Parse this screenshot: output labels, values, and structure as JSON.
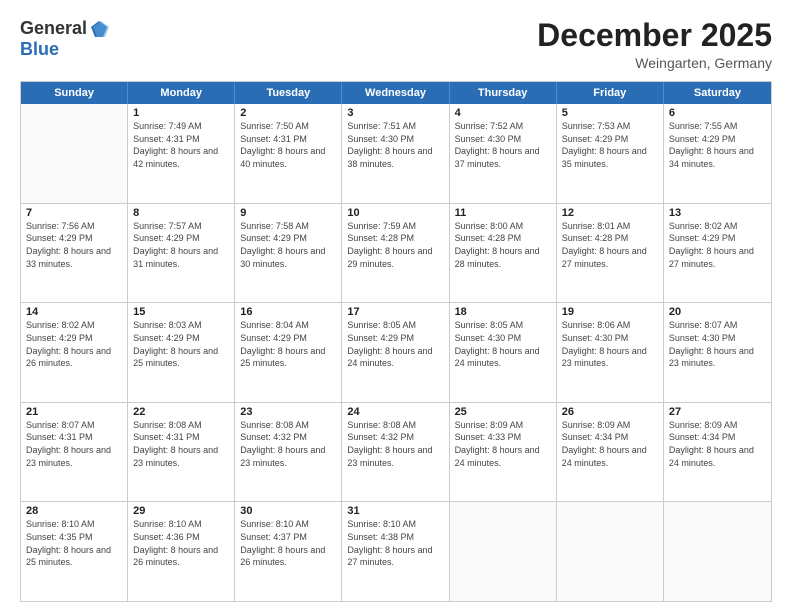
{
  "logo": {
    "general": "General",
    "blue": "Blue"
  },
  "title": "December 2025",
  "location": "Weingarten, Germany",
  "header_days": [
    "Sunday",
    "Monday",
    "Tuesday",
    "Wednesday",
    "Thursday",
    "Friday",
    "Saturday"
  ],
  "weeks": [
    [
      {
        "day": "",
        "empty": true
      },
      {
        "day": "1",
        "sunrise": "Sunrise: 7:49 AM",
        "sunset": "Sunset: 4:31 PM",
        "daylight": "Daylight: 8 hours and 42 minutes."
      },
      {
        "day": "2",
        "sunrise": "Sunrise: 7:50 AM",
        "sunset": "Sunset: 4:31 PM",
        "daylight": "Daylight: 8 hours and 40 minutes."
      },
      {
        "day": "3",
        "sunrise": "Sunrise: 7:51 AM",
        "sunset": "Sunset: 4:30 PM",
        "daylight": "Daylight: 8 hours and 38 minutes."
      },
      {
        "day": "4",
        "sunrise": "Sunrise: 7:52 AM",
        "sunset": "Sunset: 4:30 PM",
        "daylight": "Daylight: 8 hours and 37 minutes."
      },
      {
        "day": "5",
        "sunrise": "Sunrise: 7:53 AM",
        "sunset": "Sunset: 4:29 PM",
        "daylight": "Daylight: 8 hours and 35 minutes."
      },
      {
        "day": "6",
        "sunrise": "Sunrise: 7:55 AM",
        "sunset": "Sunset: 4:29 PM",
        "daylight": "Daylight: 8 hours and 34 minutes."
      }
    ],
    [
      {
        "day": "7",
        "sunrise": "Sunrise: 7:56 AM",
        "sunset": "Sunset: 4:29 PM",
        "daylight": "Daylight: 8 hours and 33 minutes."
      },
      {
        "day": "8",
        "sunrise": "Sunrise: 7:57 AM",
        "sunset": "Sunset: 4:29 PM",
        "daylight": "Daylight: 8 hours and 31 minutes."
      },
      {
        "day": "9",
        "sunrise": "Sunrise: 7:58 AM",
        "sunset": "Sunset: 4:29 PM",
        "daylight": "Daylight: 8 hours and 30 minutes."
      },
      {
        "day": "10",
        "sunrise": "Sunrise: 7:59 AM",
        "sunset": "Sunset: 4:28 PM",
        "daylight": "Daylight: 8 hours and 29 minutes."
      },
      {
        "day": "11",
        "sunrise": "Sunrise: 8:00 AM",
        "sunset": "Sunset: 4:28 PM",
        "daylight": "Daylight: 8 hours and 28 minutes."
      },
      {
        "day": "12",
        "sunrise": "Sunrise: 8:01 AM",
        "sunset": "Sunset: 4:28 PM",
        "daylight": "Daylight: 8 hours and 27 minutes."
      },
      {
        "day": "13",
        "sunrise": "Sunrise: 8:02 AM",
        "sunset": "Sunset: 4:29 PM",
        "daylight": "Daylight: 8 hours and 27 minutes."
      }
    ],
    [
      {
        "day": "14",
        "sunrise": "Sunrise: 8:02 AM",
        "sunset": "Sunset: 4:29 PM",
        "daylight": "Daylight: 8 hours and 26 minutes."
      },
      {
        "day": "15",
        "sunrise": "Sunrise: 8:03 AM",
        "sunset": "Sunset: 4:29 PM",
        "daylight": "Daylight: 8 hours and 25 minutes."
      },
      {
        "day": "16",
        "sunrise": "Sunrise: 8:04 AM",
        "sunset": "Sunset: 4:29 PM",
        "daylight": "Daylight: 8 hours and 25 minutes."
      },
      {
        "day": "17",
        "sunrise": "Sunrise: 8:05 AM",
        "sunset": "Sunset: 4:29 PM",
        "daylight": "Daylight: 8 hours and 24 minutes."
      },
      {
        "day": "18",
        "sunrise": "Sunrise: 8:05 AM",
        "sunset": "Sunset: 4:30 PM",
        "daylight": "Daylight: 8 hours and 24 minutes."
      },
      {
        "day": "19",
        "sunrise": "Sunrise: 8:06 AM",
        "sunset": "Sunset: 4:30 PM",
        "daylight": "Daylight: 8 hours and 23 minutes."
      },
      {
        "day": "20",
        "sunrise": "Sunrise: 8:07 AM",
        "sunset": "Sunset: 4:30 PM",
        "daylight": "Daylight: 8 hours and 23 minutes."
      }
    ],
    [
      {
        "day": "21",
        "sunrise": "Sunrise: 8:07 AM",
        "sunset": "Sunset: 4:31 PM",
        "daylight": "Daylight: 8 hours and 23 minutes."
      },
      {
        "day": "22",
        "sunrise": "Sunrise: 8:08 AM",
        "sunset": "Sunset: 4:31 PM",
        "daylight": "Daylight: 8 hours and 23 minutes."
      },
      {
        "day": "23",
        "sunrise": "Sunrise: 8:08 AM",
        "sunset": "Sunset: 4:32 PM",
        "daylight": "Daylight: 8 hours and 23 minutes."
      },
      {
        "day": "24",
        "sunrise": "Sunrise: 8:08 AM",
        "sunset": "Sunset: 4:32 PM",
        "daylight": "Daylight: 8 hours and 23 minutes."
      },
      {
        "day": "25",
        "sunrise": "Sunrise: 8:09 AM",
        "sunset": "Sunset: 4:33 PM",
        "daylight": "Daylight: 8 hours and 24 minutes."
      },
      {
        "day": "26",
        "sunrise": "Sunrise: 8:09 AM",
        "sunset": "Sunset: 4:34 PM",
        "daylight": "Daylight: 8 hours and 24 minutes."
      },
      {
        "day": "27",
        "sunrise": "Sunrise: 8:09 AM",
        "sunset": "Sunset: 4:34 PM",
        "daylight": "Daylight: 8 hours and 24 minutes."
      }
    ],
    [
      {
        "day": "28",
        "sunrise": "Sunrise: 8:10 AM",
        "sunset": "Sunset: 4:35 PM",
        "daylight": "Daylight: 8 hours and 25 minutes."
      },
      {
        "day": "29",
        "sunrise": "Sunrise: 8:10 AM",
        "sunset": "Sunset: 4:36 PM",
        "daylight": "Daylight: 8 hours and 26 minutes."
      },
      {
        "day": "30",
        "sunrise": "Sunrise: 8:10 AM",
        "sunset": "Sunset: 4:37 PM",
        "daylight": "Daylight: 8 hours and 26 minutes."
      },
      {
        "day": "31",
        "sunrise": "Sunrise: 8:10 AM",
        "sunset": "Sunset: 4:38 PM",
        "daylight": "Daylight: 8 hours and 27 minutes."
      },
      {
        "day": "",
        "empty": true
      },
      {
        "day": "",
        "empty": true
      },
      {
        "day": "",
        "empty": true
      }
    ]
  ]
}
